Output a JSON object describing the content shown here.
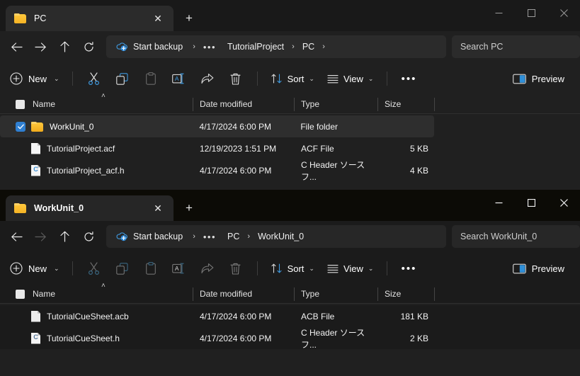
{
  "windows": [
    {
      "id": "window-pc",
      "active": false,
      "tab": {
        "title": "PC",
        "close_label": "✕",
        "new_tab_label": "+"
      },
      "caption": {
        "minimize": "minimize",
        "maximize": "maximize",
        "close": "close"
      },
      "nav": {
        "back": "back",
        "forward": "forward",
        "up": "up",
        "refresh": "refresh"
      },
      "address": {
        "backup_label": "Start backup",
        "separator": "›",
        "overflow": "•••",
        "crumbs": [
          "TutorialProject",
          "PC"
        ],
        "trailing_separator": "›"
      },
      "search": {
        "placeholder": "Search PC"
      },
      "toolbar": {
        "new_label": "New",
        "chevron": "⌄",
        "cut_label": "Cut",
        "copy_label": "Copy",
        "paste_label": "Paste",
        "rename_label": "Rename",
        "share_label": "Share",
        "delete_label": "Delete",
        "sort_label": "Sort",
        "view_label": "View",
        "more_label": "•••",
        "preview_label": "Preview"
      },
      "columns": [
        "Name",
        "Date modified",
        "Type",
        "Size"
      ],
      "sort_indicator": "˄",
      "rows": [
        {
          "name": "WorkUnit_0",
          "date": "4/17/2024 6:00 PM",
          "type": "File folder",
          "size": "",
          "icon": "folder-icon",
          "checked": true,
          "selected": true
        },
        {
          "name": "TutorialProject.acf",
          "date": "12/19/2023 1:51 PM",
          "type": "ACF File",
          "size": "5 KB",
          "icon": "document-icon",
          "checked": false,
          "selected": false
        },
        {
          "name": "TutorialProject_acf.h",
          "date": "4/17/2024 6:00 PM",
          "type": "C Header ソース フ...",
          "size": "4 KB",
          "icon": "c-header-icon",
          "checked": false,
          "selected": false
        }
      ]
    },
    {
      "id": "window-workunit0",
      "active": true,
      "tab": {
        "title": "WorkUnit_0",
        "close_label": "✕",
        "new_tab_label": "+"
      },
      "caption": {
        "minimize": "minimize",
        "maximize": "maximize",
        "close": "close"
      },
      "nav": {
        "back": "back",
        "forward": "forward",
        "up": "up",
        "refresh": "refresh"
      },
      "address": {
        "backup_label": "Start backup",
        "separator": "›",
        "overflow": "•••",
        "crumbs": [
          "PC",
          "WorkUnit_0"
        ],
        "trailing_separator": ""
      },
      "search": {
        "placeholder": "Search WorkUnit_0"
      },
      "toolbar": {
        "new_label": "New",
        "chevron": "⌄",
        "cut_label": "Cut",
        "copy_label": "Copy",
        "paste_label": "Paste",
        "rename_label": "Rename",
        "share_label": "Share",
        "delete_label": "Delete",
        "sort_label": "Sort",
        "view_label": "View",
        "more_label": "•••",
        "preview_label": "Preview"
      },
      "columns": [
        "Name",
        "Date modified",
        "Type",
        "Size"
      ],
      "sort_indicator": "˄",
      "rows": [
        {
          "name": "TutorialCueSheet.acb",
          "date": "4/17/2024 6:00 PM",
          "type": "ACB File",
          "size": "181 KB",
          "icon": "document-icon",
          "checked": false,
          "selected": false
        },
        {
          "name": "TutorialCueSheet.h",
          "date": "4/17/2024 6:00 PM",
          "type": "C Header ソース フ...",
          "size": "2 KB",
          "icon": "c-header-icon",
          "checked": false,
          "selected": false
        }
      ]
    }
  ],
  "colors": {
    "accent": "#2f7fd1",
    "folder": "#ffc83d",
    "window_bg": "#202020",
    "active_window_bg": "#1b1b1b",
    "selected_row": "#2e2e2e"
  }
}
